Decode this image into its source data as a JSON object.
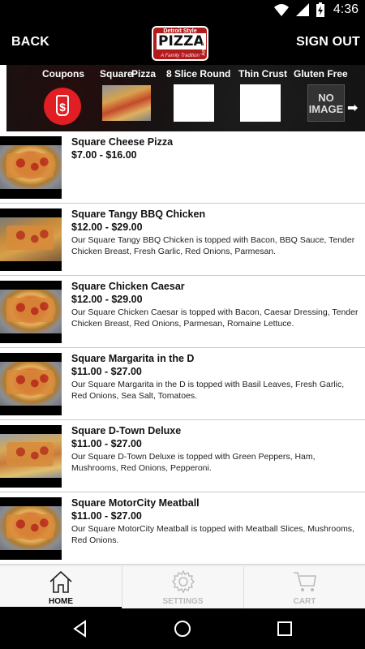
{
  "status_bar": {
    "time": "4:36"
  },
  "header": {
    "back_label": "BACK",
    "sign_out_label": "SIGN OUT",
    "logo": {
      "line1": "Detroit Style",
      "line2": "PIZZA",
      "line3": "Company",
      "line4": "A Family Tradition"
    }
  },
  "categories": [
    {
      "label": "Coupons",
      "icon": "coupon-tag-icon"
    },
    {
      "label": "Square",
      "icon": "pizza-thumbnail"
    },
    {
      "label": "Pizza",
      "icon": ""
    },
    {
      "label": "8 Slice Round",
      "icon": ""
    },
    {
      "label": "Thin Crust",
      "icon": ""
    },
    {
      "label": "Gluten Free M",
      "icon": "no-image-placeholder",
      "placeholder_text": "NO IMAGE"
    }
  ],
  "products": [
    {
      "name": "Square Cheese Pizza",
      "price": "$7.00 - $16.00",
      "description": ""
    },
    {
      "name": "Square Tangy BBQ Chicken",
      "price": "$12.00 - $29.00",
      "description": "Our Square Tangy BBQ Chicken is topped with Bacon, BBQ Sauce, Tender Chicken Breast, Fresh Garlic, Red Onions, Parmesan."
    },
    {
      "name": "Square Chicken Caesar",
      "price": "$12.00 - $29.00",
      "description": "Our Square Chicken Caesar is topped with Bacon, Caesar Dressing, Tender Chicken Breast, Red Onions, Parmesan, Romaine Lettuce."
    },
    {
      "name": "Square Margarita in the D",
      "price": "$11.00 - $27.00",
      "description": "Our Square Margarita in the D is topped with Basil Leaves, Fresh Garlic, Red Onions, Sea Salt, Tomatoes."
    },
    {
      "name": "Square D-Town Deluxe",
      "price": "$11.00 - $27.00",
      "description": "Our Square D-Town Deluxe is topped with Green Peppers, Ham, Mushrooms, Red Onions, Pepperoni."
    },
    {
      "name": "Square MotorCity Meatball",
      "price": "$11.00 - $27.00",
      "description": "Our Square MotorCity Meatball is topped with Meatball Slices, Mushrooms, Red Onions."
    }
  ],
  "tabs": [
    {
      "label": "HOME",
      "icon": "home-icon",
      "active": true
    },
    {
      "label": "SETTINGS",
      "icon": "gear-icon",
      "active": false
    },
    {
      "label": "CART",
      "icon": "cart-icon",
      "active": false
    }
  ],
  "colors": {
    "header_bg": "#000000",
    "coupon_red": "#e01e24",
    "logo_red": "#b11b1b"
  }
}
